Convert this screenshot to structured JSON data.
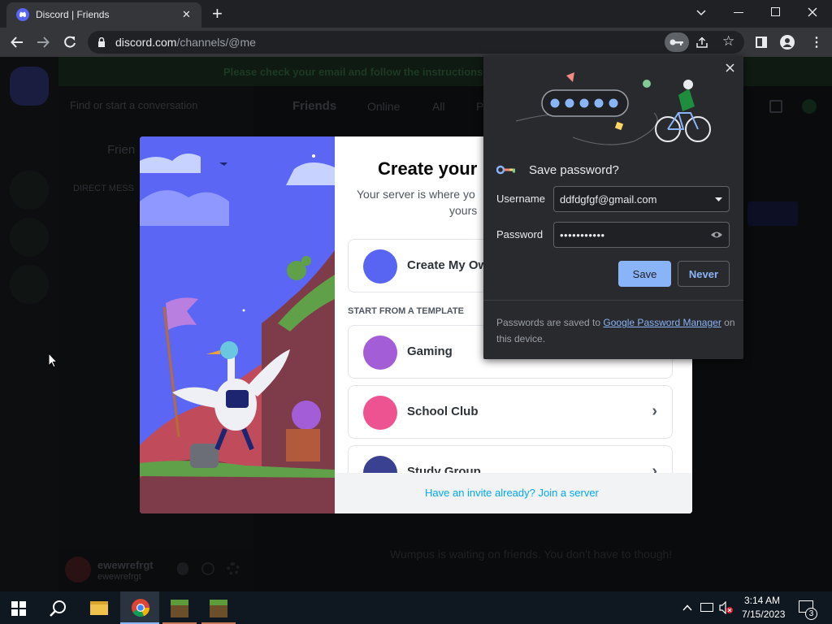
{
  "browser": {
    "tab_title": "Discord | Friends",
    "url_domain": "discord.com",
    "url_path": "/channels/@me",
    "new_tab": "+",
    "close_tab": "✕"
  },
  "discord": {
    "banner": "Please check your email and follow the instructions to",
    "search_placeholder": "Find or start a conversation",
    "friends_header": "Friends",
    "tabs": [
      "Online",
      "All",
      "P"
    ],
    "sidebar_friends": "Frien",
    "direct_messages": "DIRECT MESS",
    "username": "ewewrefrgt",
    "usertag": "ewewrefrgt",
    "bottom_text": "Wumpus is waiting on friends. You don't have to though!"
  },
  "modal": {
    "title": "Create your",
    "subtitle_line1": "Your server is where yo",
    "subtitle_line2": "yours",
    "create_own": "Create My Ow",
    "template_header": "START FROM A TEMPLATE",
    "options": [
      "Gaming",
      "School Club",
      "Study Group"
    ],
    "footer_link": "Have an invite already? Join a server"
  },
  "password_popup": {
    "title": "Save password?",
    "username_label": "Username",
    "username_value": "ddfdgfgf@gmail.com",
    "password_label": "Password",
    "password_value": "•••••••••••",
    "save_label": "Save",
    "never_label": "Never",
    "footer_pre": "Passwords are saved to ",
    "footer_link": "Google Password Manager",
    "footer_post": " on",
    "footer_line2": "this device."
  },
  "taskbar": {
    "time": "3:14 AM",
    "date": "7/15/2023",
    "notification_count": "3"
  },
  "colors": {
    "discord_blurple": "#5865f2",
    "chrome_dark": "#202124",
    "save_button": "#8ab4f8",
    "link_blue": "#00a8fc"
  }
}
